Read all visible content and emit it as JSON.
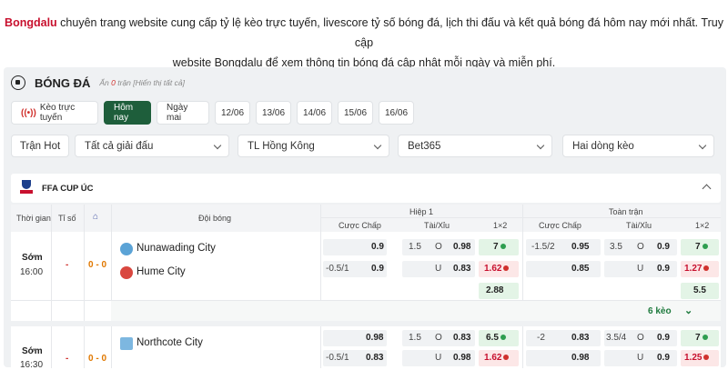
{
  "intro": {
    "brand": "Bongdalu",
    "text1": " chuyên trang website cung cấp tỷ lệ kèo trực tuyến, livescore tỷ số bóng đá, lịch thi đấu và kết quả bóng đá hôm nay mới nhất. Truy cập",
    "text2": "website Bongdalu để xem thông tin bóng đá cập nhật mỗi ngày và miễn phí."
  },
  "header": {
    "title": "BÓNG ĐÁ",
    "hidden_prefix": "Ẩn ",
    "hidden_count": "0",
    "hidden_suffix": " trận [Hiển thị tất cả]"
  },
  "tabs": [
    {
      "label": "Kèo trực tuyến",
      "icon": "live-icon"
    },
    {
      "label": "Hôm nay"
    },
    {
      "label": "Ngày mai"
    },
    {
      "label": "12/06"
    },
    {
      "label": "13/06"
    },
    {
      "label": "14/06"
    },
    {
      "label": "15/06"
    },
    {
      "label": "16/06"
    }
  ],
  "filters": {
    "hot": "Trận Hot",
    "league": "Tất cả giải đấu",
    "odds_format": "TL Hồng Kông",
    "bookmaker": "Bet365",
    "lines": "Hai dòng kèo"
  },
  "league": {
    "name": "FFA CUP ÚC"
  },
  "table_head": {
    "time": "Thời gian",
    "score": "Tỉ số",
    "team": "Đội bóng",
    "half": "Hiệp 1",
    "full": "Toàn trận",
    "handicap": "Cược Chấp",
    "ou": "Tài/Xỉu",
    "x12": "1×2"
  },
  "match1": {
    "status": "Sớm",
    "time": "16:00",
    "dash": "-",
    "score": "0 - 0",
    "home": "Nunawading City",
    "away": "Hume City",
    "h1_hc_a": "0.9",
    "h1_hc_line2": "-0.5/1",
    "h1_hc_b": "0.9",
    "h1_ou_line1": "1.5",
    "h1_ou_o": "O",
    "h1_ou_a": "0.98",
    "h1_ou_u": "U",
    "h1_ou_b": "0.83",
    "h1_x_a": "7",
    "h1_x_b": "1.62",
    "h1_x_c": "2.88",
    "ft_hc_line1": "-1.5/2",
    "ft_hc_a": "0.95",
    "ft_hc_b": "0.85",
    "ft_ou_line1": "3.5",
    "ft_ou_o": "O",
    "ft_ou_a": "0.9",
    "ft_ou_u": "U",
    "ft_ou_b": "0.9",
    "ft_x_a": "7",
    "ft_x_b": "1.27",
    "ft_x_c": "5.5",
    "more": "6 kèo"
  },
  "match2": {
    "status": "Sớm",
    "time": "16:30",
    "dash": "-",
    "score": "0 - 0",
    "home": "Northcote City",
    "h1_hc_a": "0.98",
    "h1_hc_line2": "-0.5/1",
    "h1_hc_b": "0.83",
    "h1_ou_line1": "1.5",
    "h1_ou_o": "O",
    "h1_ou_a": "0.83",
    "h1_ou_u": "U",
    "h1_ou_b": "0.98",
    "h1_x_a": "6.5",
    "h1_x_b": "1.62",
    "ft_hc_line1": "-2",
    "ft_hc_a": "0.83",
    "ft_hc_b": "0.98",
    "ft_ou_line1": "3.5/4",
    "ft_ou_o": "O",
    "ft_ou_a": "0.9",
    "ft_ou_u": "U",
    "ft_ou_b": "0.9",
    "ft_x_a": "7",
    "ft_x_b": "1.25"
  },
  "colors": {
    "brand": "#c8102e",
    "active_tab": "#1e5e3b",
    "green_cell": "#e3f4e6",
    "red_cell": "#fce7e7"
  }
}
